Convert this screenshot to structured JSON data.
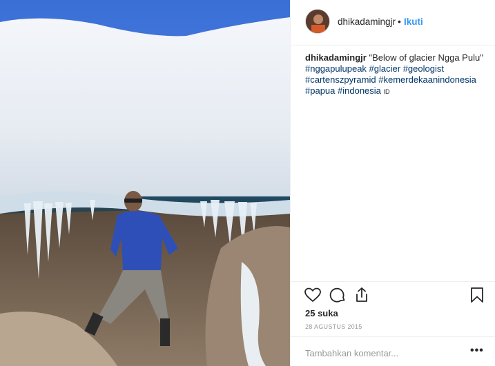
{
  "post": {
    "username": "dhikadamingjr",
    "separator": "•",
    "follow_label": "Ikuti",
    "caption": {
      "username": "dhikadamingjr",
      "text": "\"Below of glacier Ngga Pulu\"",
      "hashtags": [
        "#nggapulupeak",
        "#glacier",
        "#geologist",
        "#cartenszpyramid",
        "#kemerdekaanindonesia",
        "#papua",
        "#indonesia"
      ],
      "flag": "ID"
    },
    "actions": {
      "like_icon": "heart-icon",
      "comment_icon": "comment-bubble-icon",
      "share_icon": "share-icon",
      "save_icon": "bookmark-icon"
    },
    "likes": "25 suka",
    "date": "28 AGUSTUS 2015",
    "comment_placeholder": "Tambahkan komentar...",
    "more_label": "•••"
  },
  "colors": {
    "link": "#3897f0",
    "hashtag": "#003569",
    "muted": "#999999",
    "text": "#262626"
  }
}
